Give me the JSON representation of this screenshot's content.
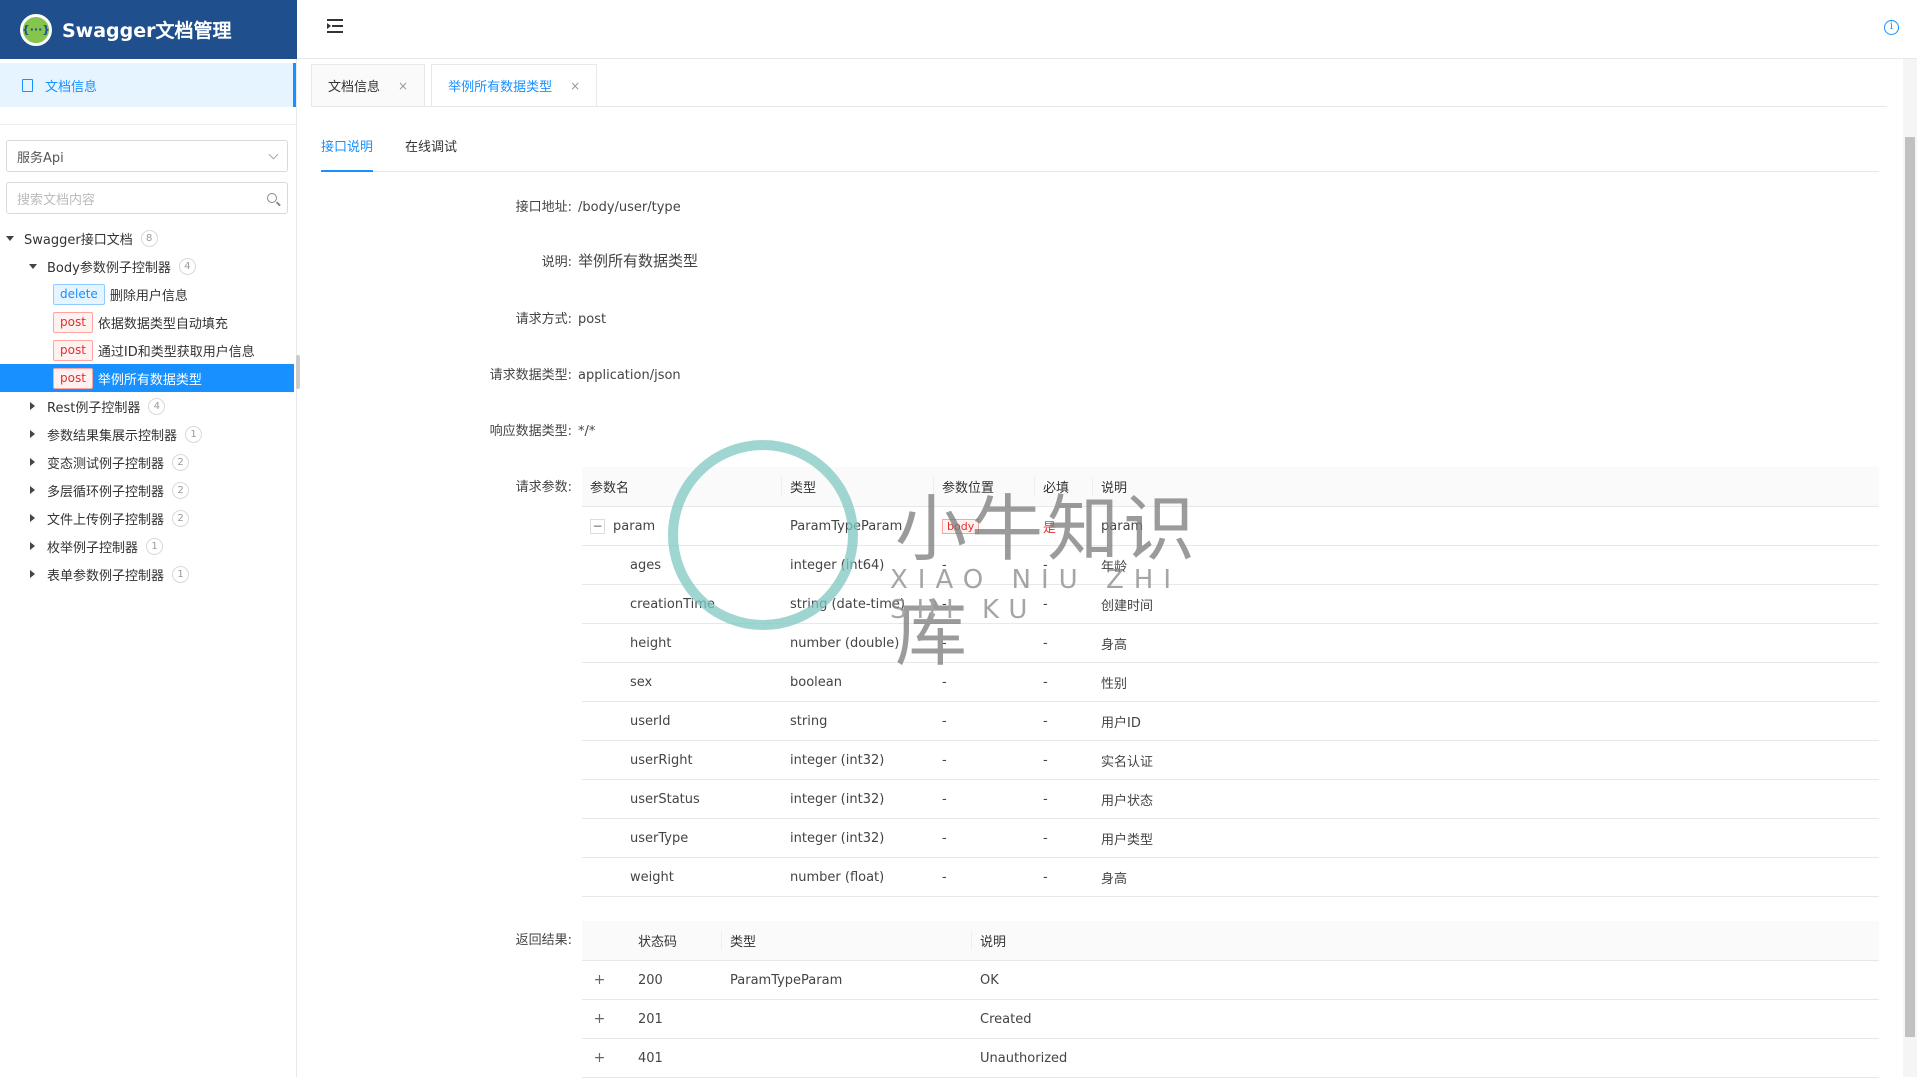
{
  "app": {
    "title": "Swagger文档管理",
    "logo_glyph": "{···}"
  },
  "sidebar": {
    "doc_info_label": "文档信息",
    "group_select": "服务Api",
    "search_placeholder": "搜索文档内容",
    "tree": {
      "root": {
        "label": "Swagger接口文档",
        "count": "8"
      },
      "body_group": {
        "label": "Body参数例子控制器",
        "count": "4"
      },
      "body_items": [
        {
          "method": "delete",
          "label": "删除用户信息"
        },
        {
          "method": "post",
          "label": "依据数据类型自动填充"
        },
        {
          "method": "post",
          "label": "通过ID和类型获取用户信息"
        },
        {
          "method": "post",
          "label": "举例所有数据类型"
        }
      ],
      "groups": [
        {
          "label": "Rest例子控制器",
          "count": "4"
        },
        {
          "label": "参数结果集展示控制器",
          "count": "1"
        },
        {
          "label": "变态测试例子控制器",
          "count": "2"
        },
        {
          "label": "多层循环例子控制器",
          "count": "2"
        },
        {
          "label": "文件上传例子控制器",
          "count": "2"
        },
        {
          "label": "枚举例子控制器",
          "count": "1"
        },
        {
          "label": "表单参数例子控制器",
          "count": "1"
        }
      ]
    }
  },
  "tabs": [
    {
      "label": "文档信息",
      "close": "×"
    },
    {
      "label": "举例所有数据类型",
      "close": "×"
    }
  ],
  "subtabs": {
    "doc": "接口说明",
    "debug": "在线调试"
  },
  "api": {
    "url_label": "接口地址:",
    "url": "/body/user/type",
    "desc_label": "说明:",
    "desc": "举例所有数据类型",
    "method_label": "请求方式:",
    "method": "post",
    "req_type_label": "请求数据类型:",
    "req_type": "application/json",
    "resp_type_label": "响应数据类型:",
    "resp_type": "*/*",
    "params_label": "请求参数:",
    "returns_label": "返回结果:"
  },
  "params": {
    "headers": [
      "参数名",
      "类型",
      "参数位置",
      "必填",
      "说明"
    ],
    "root": {
      "name": "param",
      "type": "ParamTypeParam",
      "in": "body",
      "required": "是",
      "desc": "param",
      "toggle": "−"
    },
    "rows": [
      {
        "name": "ages",
        "type": "integer (int64)",
        "in": "-",
        "required": "-",
        "desc": "年龄"
      },
      {
        "name": "creationTime",
        "type": "string (date-time)",
        "in": "-",
        "required": "-",
        "desc": "创建时间"
      },
      {
        "name": "height",
        "type": "number (double)",
        "in": "-",
        "required": "-",
        "desc": "身高"
      },
      {
        "name": "sex",
        "type": "boolean",
        "in": "-",
        "required": "-",
        "desc": "性别"
      },
      {
        "name": "userId",
        "type": "string",
        "in": "-",
        "required": "-",
        "desc": "用户ID"
      },
      {
        "name": "userRight",
        "type": "integer (int32)",
        "in": "-",
        "required": "-",
        "desc": "实名认证"
      },
      {
        "name": "userStatus",
        "type": "integer (int32)",
        "in": "-",
        "required": "-",
        "desc": "用户状态"
      },
      {
        "name": "userType",
        "type": "integer (int32)",
        "in": "-",
        "required": "-",
        "desc": "用户类型"
      },
      {
        "name": "weight",
        "type": "number (float)",
        "in": "-",
        "required": "-",
        "desc": "身高"
      }
    ]
  },
  "responses": {
    "headers": [
      "状态码",
      "类型",
      "说明"
    ],
    "rows": [
      {
        "toggle": "+",
        "code": "200",
        "type": "ParamTypeParam",
        "desc": "OK"
      },
      {
        "toggle": "+",
        "code": "201",
        "type": "",
        "desc": "Created"
      },
      {
        "toggle": "+",
        "code": "401",
        "type": "",
        "desc": "Unauthorized"
      }
    ]
  },
  "watermark": {
    "title": "小牛知识库",
    "subtitle": "XIAO NIU ZHI SHI KU"
  },
  "colors": {
    "primary": "#1890ff",
    "logo_bar": "#1f4f8c",
    "post": "#e03030"
  }
}
